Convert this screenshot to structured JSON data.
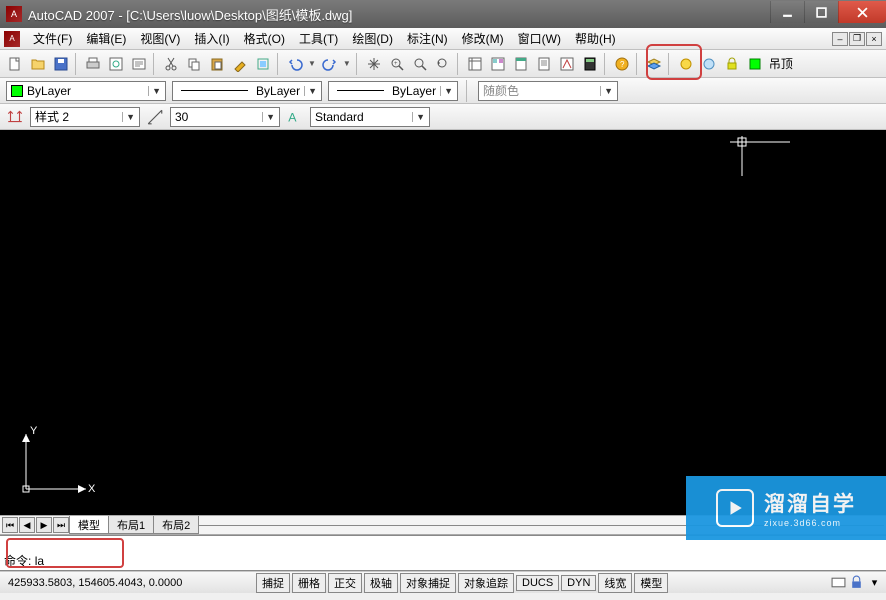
{
  "title": "AutoCAD 2007 - [C:\\Users\\luow\\Desktop\\图纸\\模板.dwg]",
  "menus": [
    "文件(F)",
    "编辑(E)",
    "视图(V)",
    "插入(I)",
    "格式(O)",
    "工具(T)",
    "绘图(D)",
    "标注(N)",
    "修改(M)",
    "窗口(W)",
    "帮助(H)"
  ],
  "layer_label": "吊顶",
  "props": {
    "color_label": "ByLayer",
    "linetype_label": "ByLayer",
    "lineweight_label": "ByLayer",
    "plotstyle_label": "随颜色"
  },
  "dim": {
    "style_label": "样式 2",
    "scale_label": "30",
    "text_style_label": "Standard"
  },
  "tabs": {
    "model": "模型",
    "layout1": "布局1",
    "layout2": "布局2"
  },
  "command": {
    "prompt": "命令:",
    "input": "la"
  },
  "coords": "425933.5803, 154605.4043, 0.0000",
  "status_buttons": [
    "捕捉",
    "栅格",
    "正交",
    "极轴",
    "对象捕捉",
    "对象追踪",
    "DUCS",
    "DYN",
    "线宽",
    "模型"
  ],
  "watermark": {
    "brand": "溜溜自学",
    "url": "zixue.3d66.com"
  },
  "ucs": {
    "x": "X",
    "y": "Y"
  }
}
